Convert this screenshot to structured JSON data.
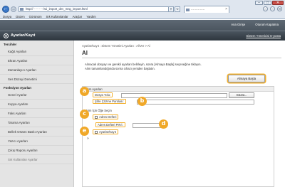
{
  "browser": {
    "address_url": "http://··········/rui_import_dev_mng_import.html",
    "tab_title": "··············",
    "back_icon": "arrow-left-icon",
    "forward_icon": "arrow-right-icon",
    "window_controls": [
      "–",
      "□",
      "✕"
    ],
    "tool_icons": [
      "home-icon",
      "star-icon",
      "gear-icon"
    ],
    "menu": [
      "Dosya",
      "Düzen",
      "Görünüm",
      "Sık Kullanılanlar",
      "Araçlar",
      "Yardım"
    ]
  },
  "header": {
    "top_buttons": [
      "Ana Girişe",
      "Oturum Kapatma"
    ],
    "app_title": "Ayarlar/Kayıt",
    "portal_link": "Sistem Yöneticisi E-posta"
  },
  "sidebar": {
    "section1": "Tercihler",
    "items1": [
      "Kağıt Ayarları",
      "Ekran Ayarları",
      "Zamanlayıcı Ayarları",
      "Ses Düzeyi Denetimi"
    ],
    "section2": "Fonksiyon Ayarları",
    "items2": [
      "Genel Ayarlar",
      "Kopya Ayarları",
      "Faks Ayarları",
      "Tarama Ayarları",
      "Bellek Ortamı Baskı Ayarları",
      "Yazıcı Ayarları",
      "Çıkış Raporu Ayarları",
      "Sık Kullanılan Ayarlar"
    ]
  },
  "main": {
    "breadcrumb": "Ayarlar/Kayıt : Sistem Yönetimi Ayarları : Al/Ver > Al",
    "title": "Al",
    "description_line1": "Alınacak dosyayı ve gerekli ayarları belirleyin, sonra [Almaya Başla] seçeneğine tıklayın.",
    "description_line2": "Alım tamamlandığında sonra cıhazı yeniden başlatın.",
    "start_button": "Almaya Başla",
    "panel_header": "Alım Ayarları",
    "file_path_label": "Dosya Yolu:",
    "browse_button": "Gözat...",
    "decrypt_label": "Şifre Çözme Parolası:",
    "subsection": "Alım İçin Öğe Seçin",
    "address_book_label": "Adres Defteri",
    "address_book_pin_label": "Adres Defteri PIN’i:",
    "settings_label": "Ayarlar/Kayıt",
    "bullet": "»"
  },
  "callouts": [
    "a",
    "b",
    "c",
    "d",
    "e"
  ]
}
